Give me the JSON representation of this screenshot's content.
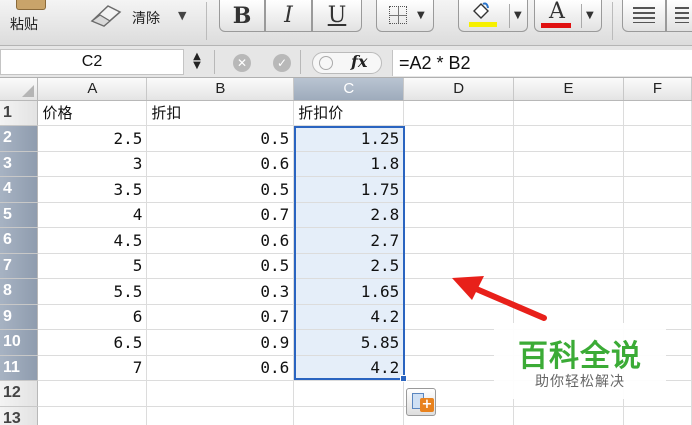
{
  "toolbar": {
    "paste_label": "粘贴",
    "clear_label": "清除",
    "bold_label": "B",
    "italic_label": "I",
    "underline_label": "U",
    "font_color_label": "A",
    "fill_color": "#f6f000",
    "font_color": "#e01010"
  },
  "formula_bar": {
    "name_box": "C2",
    "fx_label": "fx",
    "formula": "=A2 * B2"
  },
  "sheet": {
    "columns": [
      "A",
      "B",
      "C",
      "D",
      "E",
      "F"
    ],
    "selected_column": "C",
    "rows": [
      {
        "n": "1",
        "a": "价格",
        "b": "折扣",
        "c": "折扣价"
      },
      {
        "n": "2",
        "a": "2.5",
        "b": "0.5",
        "c": "1.25"
      },
      {
        "n": "3",
        "a": "3",
        "b": "0.6",
        "c": "1.8"
      },
      {
        "n": "4",
        "a": "3.5",
        "b": "0.5",
        "c": "1.75"
      },
      {
        "n": "5",
        "a": "4",
        "b": "0.7",
        "c": "2.8"
      },
      {
        "n": "6",
        "a": "4.5",
        "b": "0.6",
        "c": "2.7"
      },
      {
        "n": "7",
        "a": "5",
        "b": "0.5",
        "c": "2.5"
      },
      {
        "n": "8",
        "a": "5.5",
        "b": "0.3",
        "c": "1.65"
      },
      {
        "n": "9",
        "a": "6",
        "b": "0.7",
        "c": "4.2"
      },
      {
        "n": "10",
        "a": "6.5",
        "b": "0.9",
        "c": "5.85"
      },
      {
        "n": "11",
        "a": "7",
        "b": "0.6",
        "c": "4.2"
      },
      {
        "n": "12",
        "a": "",
        "b": "",
        "c": ""
      },
      {
        "n": "13",
        "a": "",
        "b": "",
        "c": ""
      }
    ],
    "selection_color": "#2a64c0"
  },
  "watermark": {
    "title": "百科全说",
    "subtitle": "助你轻松解决"
  }
}
